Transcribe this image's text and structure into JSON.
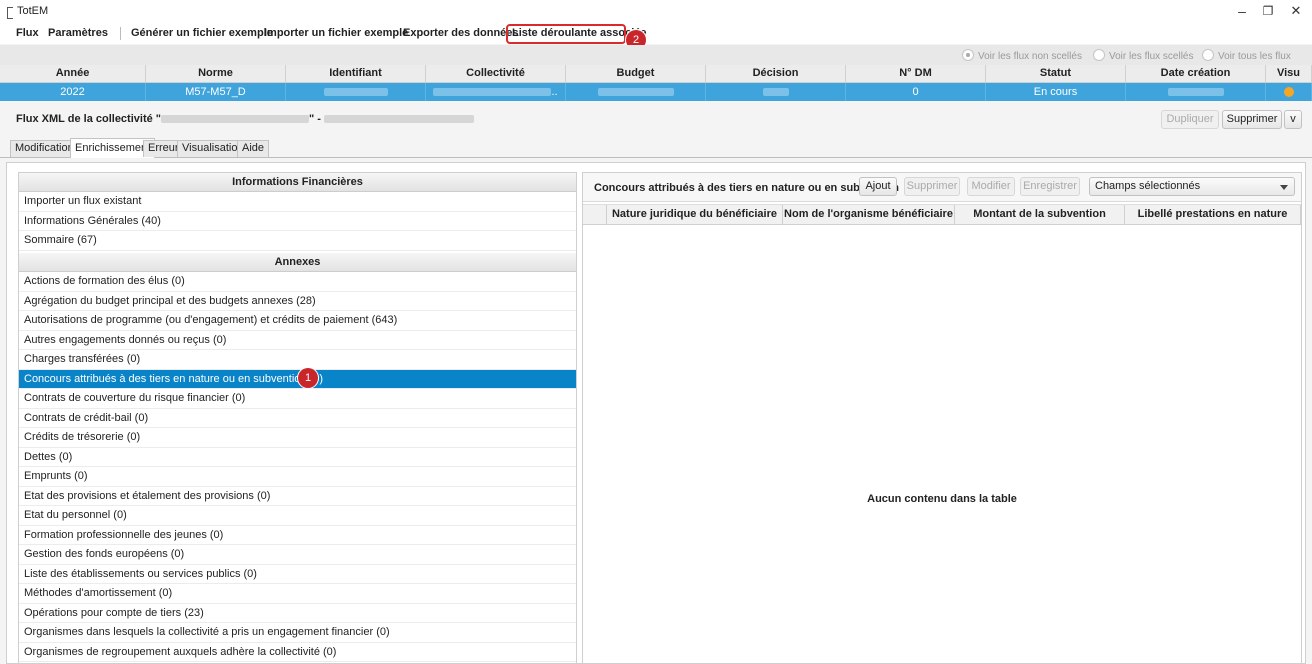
{
  "window": {
    "title": "TotEM",
    "minimize": "–",
    "maximize": "❐",
    "close": "✕"
  },
  "menu": {
    "items": [
      "Flux",
      "Paramètres",
      "Générer un fichier exemple",
      "Importer un fichier exemple",
      "Exporter des données",
      "Liste déroulante associée"
    ],
    "highlight_badge": "2"
  },
  "filters": {
    "non_scelles": "Voir les flux non scellés",
    "scelles": "Voir les flux scellés",
    "tous": "Voir tous les flux",
    "selected": "non_scelles"
  },
  "grid": {
    "headers": [
      "Année",
      "Norme",
      "Identifiant",
      "Collectivité",
      "Budget",
      "Décision",
      "N° DM",
      "Statut",
      "Date création",
      "Visu"
    ],
    "row": {
      "annee": "2022",
      "norme": "M57-M57_D",
      "collectivite_suffix": "..",
      "n_dm": "0",
      "statut": "En cours",
      "visu_color": "#f5a623"
    }
  },
  "flux": {
    "label_prefix": "Flux XML de la collectivité \"",
    "label_mid": "\" -",
    "buttons": {
      "dupliquer": "Dupliquer",
      "supprimer": "Supprimer",
      "more": "v"
    }
  },
  "tabs": [
    "Modification",
    "Enrichissement",
    "Erreur",
    "Visualisation",
    "Aide"
  ],
  "active_tab": "Enrichissement",
  "left": {
    "section1_title": "Informations Financières",
    "section1_items": [
      "Importer un flux existant",
      "Informations Générales (40)",
      "Sommaire (67)"
    ],
    "section2_title": "Annexes",
    "section2_items": [
      "Actions de formation des élus (0)",
      "Agrégation du budget principal et des budgets annexes (28)",
      "Autorisations de programme (ou d'engagement) et crédits de paiement (643)",
      "Autres engagements donnés ou reçus (0)",
      "Charges transférées (0)",
      "Concours attribués à des tiers en nature ou en subvention (0)",
      "Contrats de couverture du risque financier (0)",
      "Contrats de crédit-bail (0)",
      "Crédits de trésorerie (0)",
      "Dettes (0)",
      "Emprunts (0)",
      "Etat des provisions et étalement des provisions (0)",
      "Etat du personnel (0)",
      "Formation professionnelle des jeunes (0)",
      "Gestion des fonds européens (0)",
      "Liste des établissements ou services publics (0)",
      "Méthodes d'amortissement (0)",
      "Opérations pour compte de tiers (23)",
      "Organismes dans lesquels la collectivité a pris un engagement financier (0)",
      "Organismes de regroupement auxquels adhère la collectivité (0)"
    ],
    "selected_index": 5,
    "selected_badge": "1"
  },
  "right": {
    "title": "Concours attribués à des tiers en nature ou en subvention",
    "buttons": {
      "ajout": "Ajout",
      "supprimer": "Supprimer",
      "modifier": "Modifier",
      "enregistrer": "Enregistrer"
    },
    "select_value": "Champs sélectionnés",
    "columns": [
      "Nature juridique du bénéficiaire",
      "Nom de l'organisme bénéficiaire",
      "Montant de la subvention",
      "Libellé prestations en nature"
    ],
    "empty_message": "Aucun contenu dans la table"
  },
  "colors": {
    "selection": "#0a84c8",
    "grid_selection": "#3fa3dc",
    "badge": "#c8262b",
    "highlight_border": "#d92b2b"
  }
}
